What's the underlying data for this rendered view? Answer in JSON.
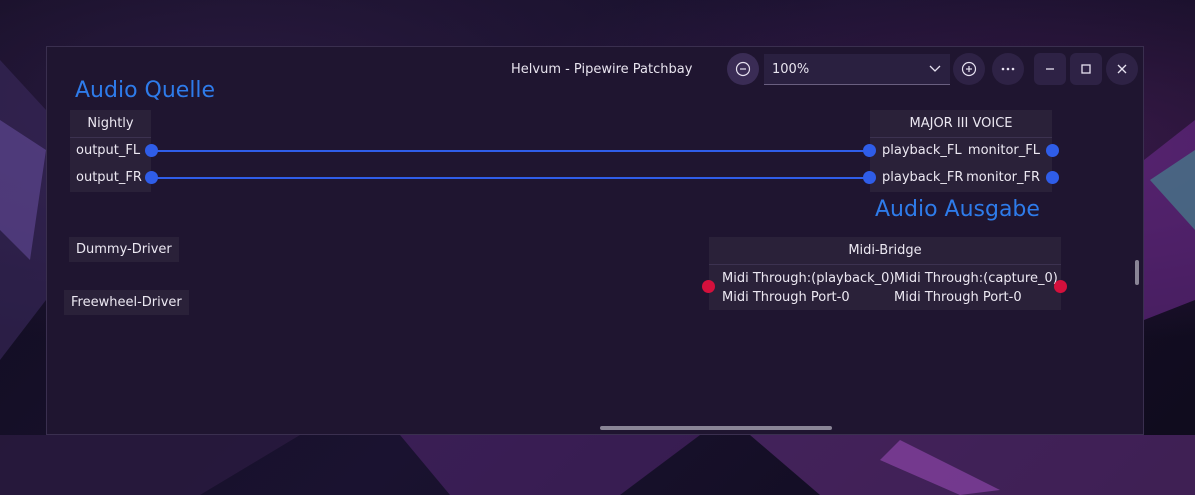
{
  "window": {
    "title": "Helvum - Pipewire Patchbay",
    "zoom": "100%",
    "icons": {
      "zoom_out": "minus-circle-icon",
      "zoom_in": "plus-circle-icon",
      "menu": "ellipsis-icon",
      "minimize": "minimize-icon",
      "maximize": "maximize-icon",
      "close": "close-icon"
    }
  },
  "labels": {
    "audio_source": "Audio Quelle",
    "audio_output": "Audio Ausgabe"
  },
  "nodes": {
    "nightly": {
      "title": "Nightly",
      "ports": [
        "output_FL",
        "output_FR"
      ]
    },
    "major": {
      "title": "MAJOR III VOICE",
      "inputs": [
        "playback_FL",
        "playback_FR"
      ],
      "outputs": [
        "monitor_FL",
        "monitor_FR"
      ]
    },
    "dummy": {
      "title": "Dummy-Driver"
    },
    "freewheel": {
      "title": "Freewheel-Driver"
    },
    "midi": {
      "title": "Midi-Bridge",
      "input_line1": "Midi Through:(playback_0)",
      "input_line2": "Midi Through Port-0",
      "output_line1": "Midi Through:(capture_0)",
      "output_line2": "Midi Through Port-0"
    }
  },
  "colors": {
    "audio_port": "#2f5de8",
    "midi_port": "#d4103c",
    "link": "#2f5de8",
    "section_title": "#2e7bea",
    "background": "#1f1530"
  }
}
